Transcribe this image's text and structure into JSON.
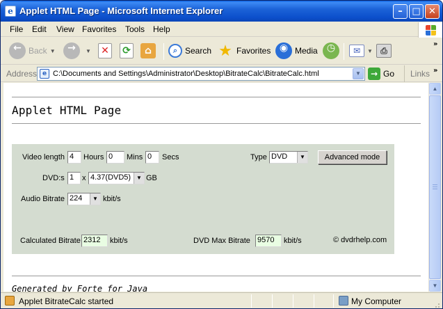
{
  "window": {
    "title": "Applet HTML Page - Microsoft Internet Explorer",
    "icon": "ie-page-icon"
  },
  "menu": {
    "items": [
      {
        "label": "File"
      },
      {
        "label": "Edit"
      },
      {
        "label": "View"
      },
      {
        "label": "Favorites"
      },
      {
        "label": "Tools"
      },
      {
        "label": "Help"
      }
    ]
  },
  "toolbar": {
    "back": "Back",
    "search": "Search",
    "favorites": "Favorites",
    "media": "Media"
  },
  "address": {
    "label": "Address",
    "value": "C:\\Documents and Settings\\Administrator\\Desktop\\BitrateCalc\\BitrateCalc.html",
    "go": "Go",
    "links": "Links"
  },
  "page": {
    "title": "Applet HTML Page",
    "footer": "Generated by Forte for Java"
  },
  "applet": {
    "video_length_label": "Video length",
    "hours_value": "4",
    "hours_label": "Hours",
    "mins_value": "0",
    "mins_label": "Mins",
    "secs_value": "0",
    "secs_label": "Secs",
    "type_label": "Type",
    "type_value": "DVD",
    "advanced_button": "Advanced mode",
    "dvds_label": "DVD:s",
    "dvds_value": "1",
    "times": "x",
    "dvd_size_value": "4.37(DVD5)",
    "gb_label": "GB",
    "audio_label": "Audio Bitrate",
    "audio_value": "224",
    "audio_unit": "kbit/s",
    "calc_label": "Calculated Bitrate",
    "calc_value": "2312",
    "calc_unit": "kbit/s",
    "max_label": "DVD Max Bitrate",
    "max_value": "9570",
    "max_unit": "kbit/s",
    "credit": "© dvdrhelp.com"
  },
  "status": {
    "text": "Applet BitrateCalc started",
    "zone": "My Computer"
  }
}
